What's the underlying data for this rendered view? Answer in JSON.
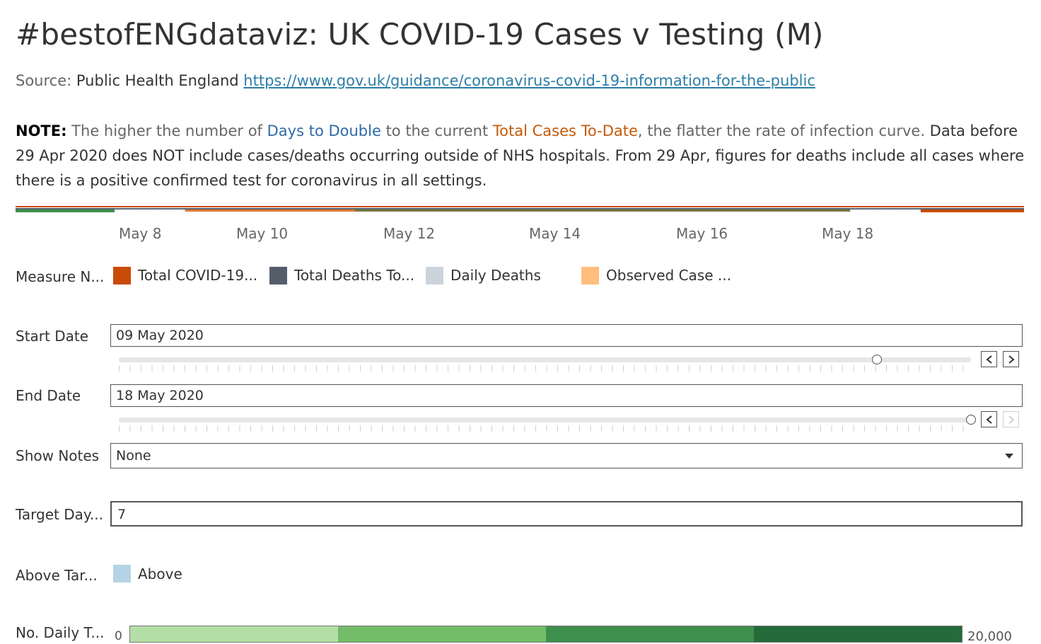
{
  "title": "#bestofENGdataviz: UK COVID-19 Cases v Testing (M)",
  "source": {
    "prefix": "Source: ",
    "publisher": "Public Health England",
    "url": "https://www.gov.uk/guidance/coronavirus-covid-19-information-for-the-public"
  },
  "note": {
    "label": "NOTE:",
    "part1": " The higher the number of ",
    "days_to_double": "Days to Double",
    "part2": " to the current ",
    "total_cases": "Total Cases To-Date",
    "part3": ", the flatter the rate of infection curve. ",
    "part4": "Data before 29 Apr 2020 does NOT include cases/deaths occurring outside of NHS hospitals. From 29 Apr, figures for deaths include all cases where there is a positive confirmed test for coronavirus in all settings."
  },
  "chart_axis": {
    "ticks": [
      "May 8",
      "May 10",
      "May 12",
      "May 14",
      "May 16",
      "May 18"
    ]
  },
  "legend_measure": {
    "title": "Measure N...",
    "items": [
      {
        "label": "Total COVID-19...",
        "color": "#c84b09"
      },
      {
        "label": "Total Deaths To...",
        "color": "#555d6b"
      },
      {
        "label": "Daily Deaths",
        "color": "#cdd3dc"
      },
      {
        "label": "Observed Case ...",
        "color": "#ffbe7d"
      }
    ]
  },
  "filters": {
    "start_date": {
      "label": "Start Date",
      "value": "09 May 2020",
      "slider_fraction": 0.89
    },
    "end_date": {
      "label": "End Date",
      "value": "18 May 2020",
      "slider_fraction": 1.0
    },
    "show_notes": {
      "label": "Show Notes",
      "value": "None"
    },
    "target_days": {
      "label": "Target Day...",
      "value": "7"
    }
  },
  "legend_above": {
    "title": "Above Tar...",
    "item": {
      "label": "Above",
      "color": "#b4d4e6"
    }
  },
  "legend_daily_tests": {
    "title": "No. Daily T...",
    "min": "0",
    "max": "20,000",
    "colors": [
      "#b3dfa6",
      "#74bb6a",
      "#3e8e4e",
      "#246b3a"
    ]
  },
  "icons": {
    "prev": "chevron-left-icon",
    "next": "chevron-right-icon",
    "dropdown": "caret-down-icon"
  }
}
